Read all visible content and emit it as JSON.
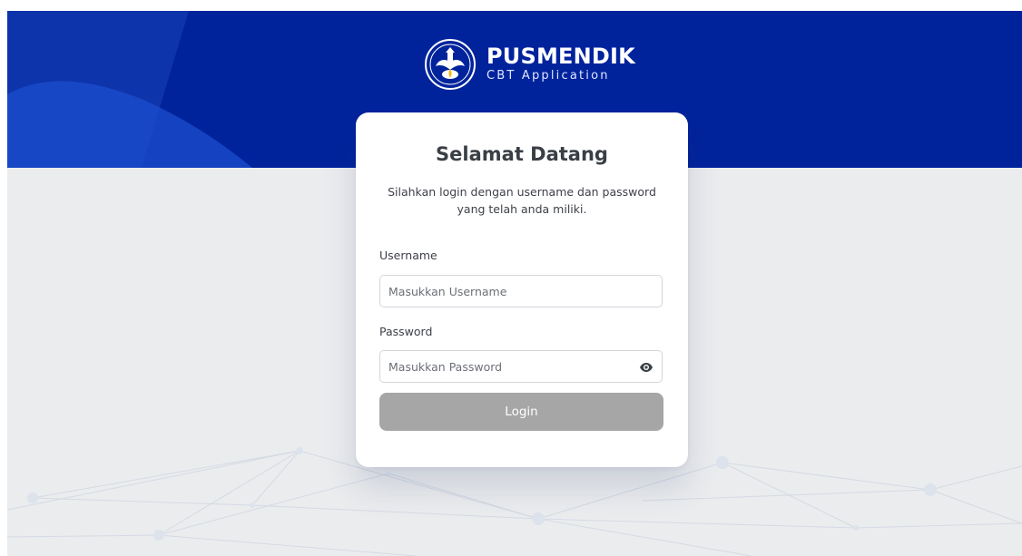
{
  "brand": {
    "title": "PUSMENDIK",
    "subtitle": "CBT Application",
    "emblem_icon": "tut-wuri-handayani-emblem-icon"
  },
  "login": {
    "title": "Selamat Datang",
    "subtitle": "Silahkan login dengan username dan password yang telah anda miliki.",
    "username": {
      "label": "Username",
      "placeholder": "Masukkan Username",
      "value": ""
    },
    "password": {
      "label": "Password",
      "placeholder": "Masukkan Password",
      "value": "",
      "toggle_icon": "eye-icon"
    },
    "button_label": "Login"
  },
  "colors": {
    "header_blue": "#00239c",
    "page_background": "#ebecee",
    "card": "#ffffff",
    "login_button": "#a6a6a6"
  }
}
